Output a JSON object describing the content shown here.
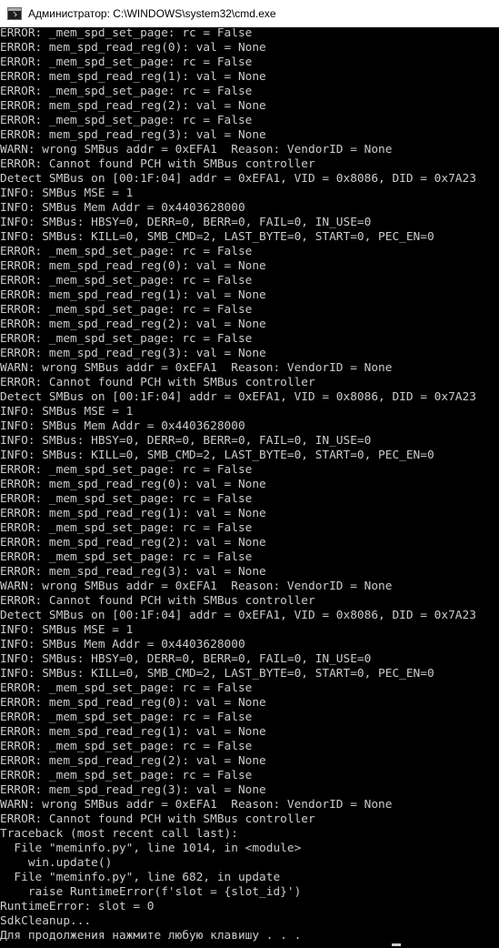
{
  "window": {
    "title": "Администратор: C:\\WINDOWS\\system32\\cmd.exe",
    "icon": "cmd-console-icon"
  },
  "console": {
    "lines": [
      "ERROR: _mem_spd_set_page: rc = False",
      "ERROR: mem_spd_read_reg(0): val = None",
      "ERROR: _mem_spd_set_page: rc = False",
      "ERROR: mem_spd_read_reg(1): val = None",
      "ERROR: _mem_spd_set_page: rc = False",
      "ERROR: mem_spd_read_reg(2): val = None",
      "ERROR: _mem_spd_set_page: rc = False",
      "ERROR: mem_spd_read_reg(3): val = None",
      "WARN: wrong SMBus addr = 0xEFA1  Reason: VendorID = None",
      "ERROR: Cannot found PCH with SMBus controller",
      "Detect SMBus on [00:1F:04] addr = 0xEFA1, VID = 0x8086, DID = 0x7A23",
      "INFO: SMBus MSE = 1",
      "INFO: SMBus Mem Addr = 0x4403628000",
      "INFO: SMBus: HBSY=0, DERR=0, BERR=0, FAIL=0, IN_USE=0",
      "INFO: SMBus: KILL=0, SMB_CMD=2, LAST_BYTE=0, START=0, PEC_EN=0",
      "ERROR: _mem_spd_set_page: rc = False",
      "ERROR: mem_spd_read_reg(0): val = None",
      "ERROR: _mem_spd_set_page: rc = False",
      "ERROR: mem_spd_read_reg(1): val = None",
      "ERROR: _mem_spd_set_page: rc = False",
      "ERROR: mem_spd_read_reg(2): val = None",
      "ERROR: _mem_spd_set_page: rc = False",
      "ERROR: mem_spd_read_reg(3): val = None",
      "WARN: wrong SMBus addr = 0xEFA1  Reason: VendorID = None",
      "ERROR: Cannot found PCH with SMBus controller",
      "Detect SMBus on [00:1F:04] addr = 0xEFA1, VID = 0x8086, DID = 0x7A23",
      "INFO: SMBus MSE = 1",
      "INFO: SMBus Mem Addr = 0x4403628000",
      "INFO: SMBus: HBSY=0, DERR=0, BERR=0, FAIL=0, IN_USE=0",
      "INFO: SMBus: KILL=0, SMB_CMD=2, LAST_BYTE=0, START=0, PEC_EN=0",
      "ERROR: _mem_spd_set_page: rc = False",
      "ERROR: mem_spd_read_reg(0): val = None",
      "ERROR: _mem_spd_set_page: rc = False",
      "ERROR: mem_spd_read_reg(1): val = None",
      "ERROR: _mem_spd_set_page: rc = False",
      "ERROR: mem_spd_read_reg(2): val = None",
      "ERROR: _mem_spd_set_page: rc = False",
      "ERROR: mem_spd_read_reg(3): val = None",
      "WARN: wrong SMBus addr = 0xEFA1  Reason: VendorID = None",
      "ERROR: Cannot found PCH with SMBus controller",
      "Detect SMBus on [00:1F:04] addr = 0xEFA1, VID = 0x8086, DID = 0x7A23",
      "INFO: SMBus MSE = 1",
      "INFO: SMBus Mem Addr = 0x4403628000",
      "INFO: SMBus: HBSY=0, DERR=0, BERR=0, FAIL=0, IN_USE=0",
      "INFO: SMBus: KILL=0, SMB_CMD=2, LAST_BYTE=0, START=0, PEC_EN=0",
      "ERROR: _mem_spd_set_page: rc = False",
      "ERROR: mem_spd_read_reg(0): val = None",
      "ERROR: _mem_spd_set_page: rc = False",
      "ERROR: mem_spd_read_reg(1): val = None",
      "ERROR: _mem_spd_set_page: rc = False",
      "ERROR: mem_spd_read_reg(2): val = None",
      "ERROR: _mem_spd_set_page: rc = False",
      "ERROR: mem_spd_read_reg(3): val = None",
      "WARN: wrong SMBus addr = 0xEFA1  Reason: VendorID = None",
      "ERROR: Cannot found PCH with SMBus controller",
      "Traceback (most recent call last):",
      "  File \"meminfo.py\", line 1014, in <module>",
      "    win.update()",
      "  File \"meminfo.py\", line 682, in update",
      "    raise RuntimeError(f'slot = {slot_id}')",
      "RuntimeError: slot = 0",
      "SdkCleanup...",
      "Для продолжения нажмите любую клавишу . . ."
    ]
  },
  "colors": {
    "background": "#000000",
    "text": "#cccccc",
    "titlebar": "#ffffff"
  }
}
